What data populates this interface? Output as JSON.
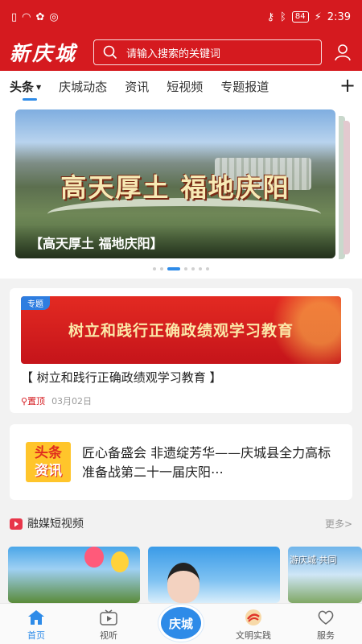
{
  "status_bar": {
    "time": "2:39",
    "battery": "84",
    "left_icons": [
      "sim-icon",
      "wifi-icon",
      "color-app-icon",
      "dnd-icon"
    ],
    "right_icons": [
      "key-icon",
      "bluetooth-icon",
      "battery-icon",
      "charging-icon"
    ]
  },
  "header": {
    "logo": "新庆城",
    "search_placeholder": "请输入搜索的关键词"
  },
  "tabs": [
    {
      "label": "头条",
      "active": true
    },
    {
      "label": "庆城动态"
    },
    {
      "label": "资讯"
    },
    {
      "label": "短视频"
    },
    {
      "label": "专题报道"
    }
  ],
  "banner": {
    "image_text": "高天厚土 福地庆阳",
    "caption": "【高天厚土 福地庆阳】"
  },
  "feature": {
    "tag": "专题",
    "image_text": "树立和践行正确政绩观学习教育",
    "title": "【 树立和践行正确政绩观学习教育 】",
    "pin_label": "置顶",
    "date": "03月02日"
  },
  "news": {
    "logo_top": "头条",
    "logo_bottom": "资讯",
    "text": "匠心备盛会 非遗绽芳华——庆城县全力高标准备战第二十一届庆阳⋯"
  },
  "video_section": {
    "title": "融媒短视频",
    "more": "更多>",
    "thumb3_text": "游庆城·共同"
  },
  "bottom_nav": [
    {
      "label": "首页",
      "active": true
    },
    {
      "label": "视听"
    },
    {
      "label": "庆城"
    },
    {
      "label": "文明实践"
    },
    {
      "label": "服务"
    }
  ],
  "colors": {
    "brand_red": "#d51a1f",
    "accent_blue": "#2e8be8"
  }
}
